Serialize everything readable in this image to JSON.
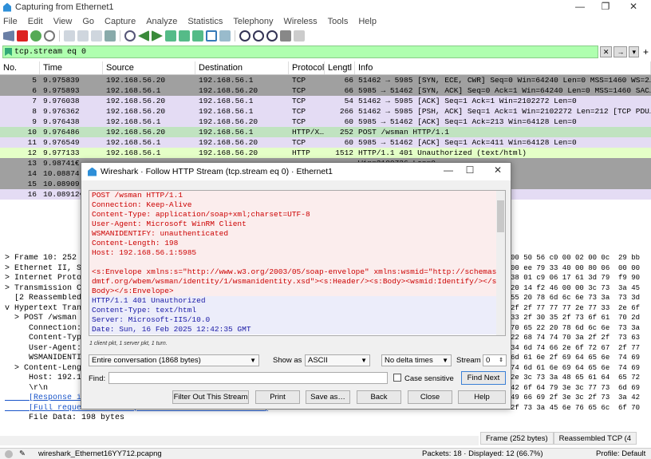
{
  "window": {
    "title": "Capturing from Ethernet1",
    "min": "—",
    "max": "❐",
    "close": "✕"
  },
  "menu": [
    "File",
    "Edit",
    "View",
    "Go",
    "Capture",
    "Analyze",
    "Statistics",
    "Telephony",
    "Wireless",
    "Tools",
    "Help"
  ],
  "filter": {
    "value": "tcp.stream eq 0",
    "clear": "✕",
    "arrow": "→",
    "dropdown": "▾",
    "plus": "+"
  },
  "packet_list": {
    "headers": [
      "No.",
      "Time",
      "Source",
      "Destination",
      "Protocol",
      "Lengtl",
      "Info"
    ],
    "rows": [
      {
        "no": "5",
        "time": "9.975839",
        "src": "192.168.56.20",
        "dst": "192.168.56.1",
        "proto": "TCP",
        "len": "66",
        "info": "51462 → 5985 [SYN, ECE, CWR] Seq=0 Win=64240 Len=0 MSS=1460 WS=2…",
        "style": "r-gray"
      },
      {
        "no": "6",
        "time": "9.975893",
        "src": "192.168.56.1",
        "dst": "192.168.56.20",
        "proto": "TCP",
        "len": "66",
        "info": "5985 → 51462 [SYN, ACK] Seq=0 Ack=1 Win=64240 Len=0 MSS=1460 SAC…",
        "style": "r-gray"
      },
      {
        "no": "7",
        "time": "9.976038",
        "src": "192.168.56.20",
        "dst": "192.168.56.1",
        "proto": "TCP",
        "len": "54",
        "info": "51462 → 5985 [ACK] Seq=1 Ack=1 Win=2102272 Len=0",
        "style": "r-purple"
      },
      {
        "no": "8",
        "time": "9.976362",
        "src": "192.168.56.20",
        "dst": "192.168.56.1",
        "proto": "TCP",
        "len": "266",
        "info": "51462 → 5985 [PSH, ACK] Seq=1 Ack=1 Win=2102272 Len=212 [TCP PDU…",
        "style": "r-purple"
      },
      {
        "no": "9",
        "time": "9.976438",
        "src": "192.168.56.1",
        "dst": "192.168.56.20",
        "proto": "TCP",
        "len": "60",
        "info": "5985 → 51462 [ACK] Seq=1 Ack=213 Win=64128 Len=0",
        "style": "r-purple"
      },
      {
        "no": "10",
        "time": "9.976486",
        "src": "192.168.56.20",
        "dst": "192.168.56.1",
        "proto": "HTTP/X…",
        "len": "252",
        "info": "POST /wsman HTTP/1.1",
        "style": "r-sel"
      },
      {
        "no": "11",
        "time": "9.976549",
        "src": "192.168.56.1",
        "dst": "192.168.56.20",
        "proto": "TCP",
        "len": "60",
        "info": "5985 → 51462 [ACK] Seq=1 Ack=411 Win=64128 Len=0",
        "style": "r-purple"
      },
      {
        "no": "12",
        "time": "9.977133",
        "src": "192.168.56.1",
        "dst": "192.168.56.20",
        "proto": "HTTP",
        "len": "1512",
        "info": "HTTP/1.1 401 Unauthorized  (text/html)",
        "style": "r-green"
      },
      {
        "no": "13",
        "time": "9.98741€",
        "src": "",
        "dst": "",
        "proto": "",
        "len": "",
        "info": "Win=2100736 Len=0",
        "style": "r-gray"
      },
      {
        "no": "14",
        "time": "10.08874",
        "src": "",
        "dst": "",
        "proto": "",
        "len": "",
        "info": "1459 Win=2100736 Len=0",
        "style": "r-gray"
      },
      {
        "no": "15",
        "time": "10.08909",
        "src": "",
        "dst": "",
        "proto": "",
        "len": "",
        "info": "=412 Win=64128 Len=0",
        "style": "r-gray"
      },
      {
        "no": "16",
        "time": "10.08912€",
        "src": "",
        "dst": "",
        "proto": "",
        "len": "",
        "info": "Win=2100736 Len=0",
        "style": "r-purple"
      }
    ]
  },
  "details": [
    {
      "text": "> Frame 10: 252 b",
      "link": false
    },
    {
      "text": "> Ethernet II, Sr",
      "link": false
    },
    {
      "text": "> Internet Protoc",
      "link": false
    },
    {
      "text": "> Transmission Co",
      "link": false
    },
    {
      "text": "  [2 Reassembled",
      "link": false
    },
    {
      "text": "v Hypertext Trans",
      "link": false
    },
    {
      "text": "  > POST /wsman",
      "link": false
    },
    {
      "text": "     Connection:",
      "link": false
    },
    {
      "text": "     Content-Type",
      "link": false
    },
    {
      "text": "     User-Agent:",
      "link": false
    },
    {
      "text": "     WSMANIDENTIF",
      "link": false
    },
    {
      "text": "  > Content-Leng",
      "link": false
    },
    {
      "text": "     Host: 192.16",
      "link": false
    },
    {
      "text": "     \\r\\n",
      "link": false
    },
    {
      "text": "     [Response in frame: 12]",
      "link": true
    },
    {
      "text": "     [Full request URI: http://192.168.56.1:5985/wsman]",
      "link": true
    },
    {
      "text": "     File Data: 198 bytes",
      "link": false
    }
  ],
  "hex": [
    "00 50 56 c0 00 02 00 0c  29 bb",
    "00 ee 79 33 40 00 80 06  00 00",
    "38 01 c9 06 17 61 3d 79  f9 90",
    "20 14 f2 46 00 00 3c 73  3a 45",
    "55 20 78 6d 6c 6e 73 3a  73 3d",
    "2f 2f 77 77 77 2e 77 33  2e 6f",
    "33 2f 30 35 2f 73 6f 61  70 2d",
    "70 65 22 20 78 6d 6c 6e  73 3a",
    "22 68 74 74 70 3a 2f 2f  73 63",
    "34 6d 74 66 2e 6f 72 67  2f 77",
    "6d 61 6e 2f 69 64 65 6e  74 69",
    "74 6d 61 6e 69 64 65 6e  74 69",
    "2e 3c 73 3a 48 65 61 64  65 72",
    "42 6f 64 79 3e 3c 77 73  6d 69",
    "49 66 69 2f 3e 3c 2f 73  3a 42",
    "2f 73 3a 45 6e 76 65 6c  6f 70"
  ],
  "hex_tabs": [
    "Frame (252 bytes)",
    "Reassembled TCP (4"
  ],
  "status": {
    "file": "wireshark_Ethernet16YY712.pcapng",
    "packets": "Packets: 18 · Displayed: 12 (66.7%)",
    "profile": "Profile: Default"
  },
  "dialog": {
    "title": "Wireshark · Follow HTTP Stream (tcp.stream eq 0) · Ethernet1",
    "stream_lines": [
      {
        "text": "POST /wsman HTTP/1.1",
        "who": "cl"
      },
      {
        "text": "Connection: Keep-Alive",
        "who": "cl"
      },
      {
        "text": "Content-Type: application/soap+xml;charset=UTF-8",
        "who": "cl"
      },
      {
        "text": "User-Agent: Microsoft WinRM Client",
        "who": "cl"
      },
      {
        "text": "WSMANIDENTIFY: unauthenticated",
        "who": "cl"
      },
      {
        "text": "Content-Length: 198",
        "who": "cl"
      },
      {
        "text": "Host: 192.168.56.1:5985",
        "who": "cl"
      },
      {
        "text": "",
        "who": "cl"
      },
      {
        "text": "<s:Envelope xmlns:s=\"http://www.w3.org/2003/05/soap-envelope\" xmlns:wsmid=\"http://schemas.",
        "who": "cl"
      },
      {
        "text": "dmtf.org/wbem/wsman/identity/1/wsmanidentity.xsd\"><s:Header/><s:Body><wsmid:Identify/></s:",
        "who": "cl"
      },
      {
        "text": "Body></s:Envelope>",
        "who": "cl"
      },
      {
        "text": "HTTP/1.1 401 Unauthorized",
        "who": "sv"
      },
      {
        "text": "Content-Type: text/html",
        "who": "sv"
      },
      {
        "text": "Server: Microsoft-IIS/10.0",
        "who": "sv"
      },
      {
        "text": "Date: Sun, 16 Feb 2025 12:42:35 GMT",
        "who": "sv"
      }
    ],
    "stream_info": "1 client pkt, 1 server pkt, 1 turn.",
    "conversation": "Entire conversation (1868 bytes)",
    "show_as_label": "Show as",
    "show_as": "ASCII",
    "delta": "No delta times",
    "stream_label": "Stream",
    "stream_value": "0",
    "find_label": "Find:",
    "find_value": "",
    "case_sensitive": "Case sensitive",
    "find_next": "Find Next",
    "buttons": [
      "Filter Out This Stream",
      "Print",
      "Save as…",
      "Back",
      "Close",
      "Help"
    ]
  }
}
